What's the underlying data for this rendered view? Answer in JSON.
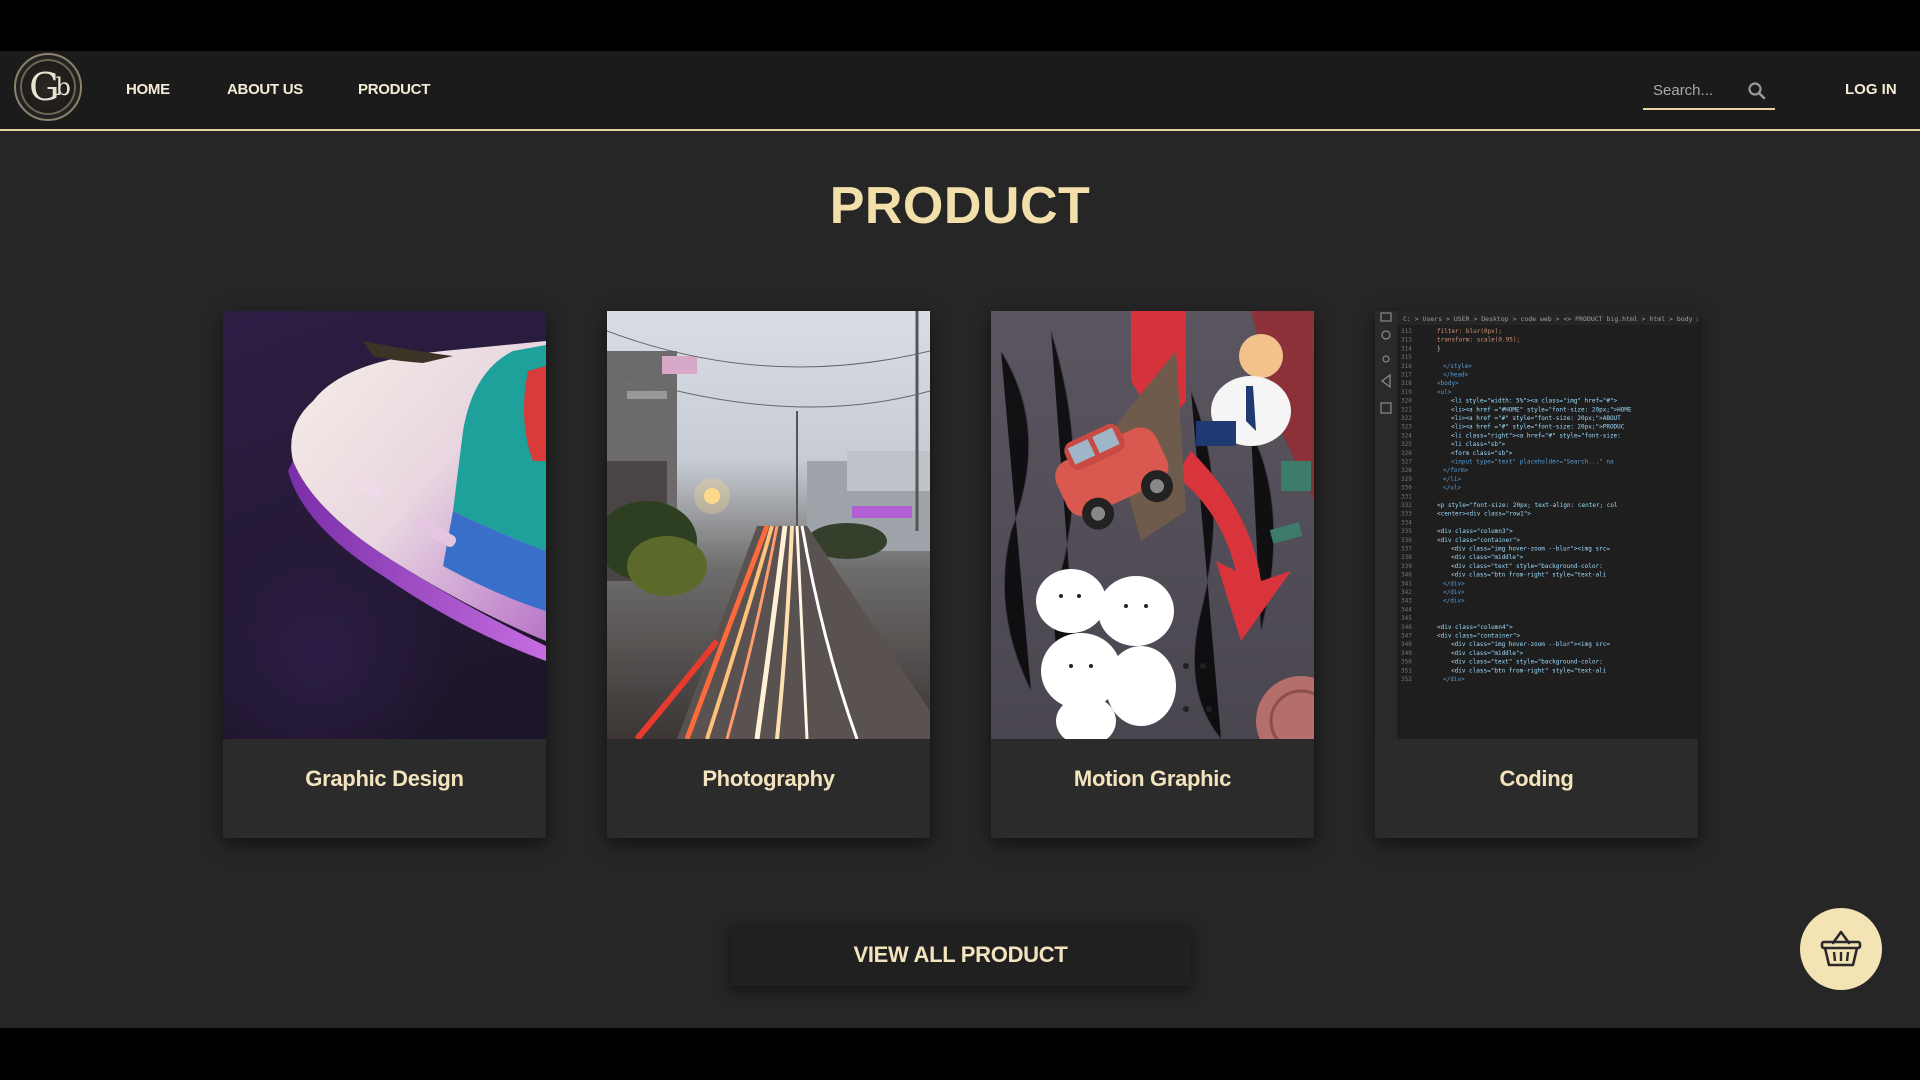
{
  "nav": {
    "logo_text": "G",
    "logo_sub": "b",
    "links": [
      "HOME",
      "ABOUT US",
      "PRODUCT"
    ],
    "search_placeholder": "Search...",
    "login_label": "LOG IN"
  },
  "page": {
    "title": "PRODUCT"
  },
  "products": [
    {
      "label": "Graphic Design"
    },
    {
      "label": "Photography"
    },
    {
      "label": "Motion Graphic"
    },
    {
      "label": "Coding"
    }
  ],
  "view_all_label": "VIEW ALL PRODUCT",
  "icons": {
    "search": "search-icon",
    "basket": "basket-icon"
  },
  "colors": {
    "accent": "#f3dfa9",
    "nav_border": "#e7d3a3",
    "background": "#262626",
    "basket_bg": "#f4e3b5"
  },
  "code_lines": [
    "filter: blur(0px);",
    "transform: scale(0.95);",
    "}",
    "",
    "</style>",
    "</head>",
    "<body>",
    "<ul>",
    "<li style=\"width: 5%\"><a class=\"img\" href=\"#\">",
    "<li><a href =\"#HOME\" style=\"font-size: 20px;\">HOME",
    "<li><a href =\"#\" style=\"font-size: 20px;\">ABOUT",
    "<li><a href =\"#\" style=\"font-size: 20px;\">PRODUC",
    "<li class=\"right\"><a href=\"#\" style=\"font-size:",
    "<li class=\"sb\">",
    "<form class=\"sb\">",
    "<input type=\"text\" placeholder=\"Search...\" na",
    "</form>",
    "</li>",
    "</ul>",
    "",
    "<p style=\"font-size: 20px; text-align: center; col",
    "<center><div class=\"row1\">",
    "",
    "<div class=\"column3\">",
    "<div class=\"container\">",
    "<div class=\"img hover-zoom --blur\"><img src=",
    "<div class=\"middle\">",
    "<div class=\"text\" style=\"background-color:",
    "<div class=\"btn from-right\" style=\"text-ali",
    "</div>",
    "</div>",
    "</div>",
    "",
    "",
    "<div class=\"column4\">",
    "<div class=\"container\">",
    "<div class=\"img hover-zoom --blur\"><img src=",
    "<div class=\"middle\">",
    "<div class=\"text\" style=\"background-color:",
    "<div class=\"btn from-right\" style=\"text-ali",
    "</div>"
  ],
  "code_breadcrumb": "C: > Users > USER > Desktop > code web > <> PRODUCT big.html > html > body > center"
}
